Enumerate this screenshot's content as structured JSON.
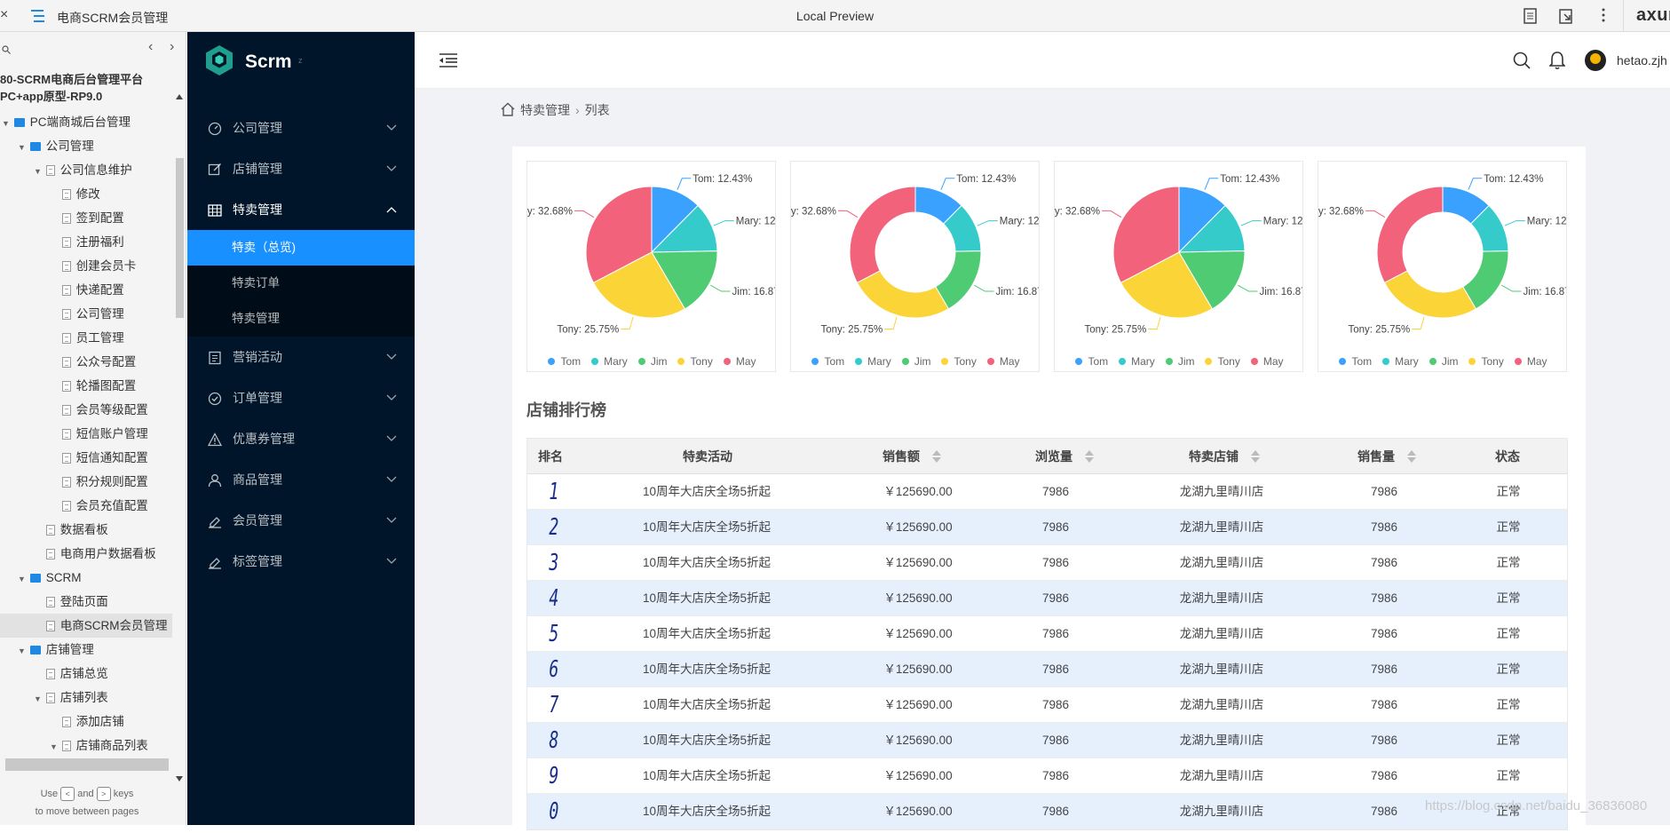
{
  "topbar": {
    "close": "×",
    "project_title": "电商SCRM会员管理",
    "preview_label": "Local Preview",
    "brand": "axur"
  },
  "tree": {
    "title_line1": "80-SCRM电商后台管理平台",
    "title_line2": "PC+app原型-RP9.0",
    "items": [
      {
        "label": "PC端商城后台管理",
        "type": "folder",
        "level": 0,
        "expanded": true
      },
      {
        "label": "公司管理",
        "type": "folder",
        "level": 1,
        "expanded": true
      },
      {
        "label": "公司信息维护",
        "type": "page",
        "level": 2,
        "expanded": true
      },
      {
        "label": "修改",
        "type": "page",
        "level": 3
      },
      {
        "label": "签到配置",
        "type": "page",
        "level": 3
      },
      {
        "label": "注册福利",
        "type": "page",
        "level": 3
      },
      {
        "label": "创建会员卡",
        "type": "page",
        "level": 3
      },
      {
        "label": "快递配置",
        "type": "page",
        "level": 3
      },
      {
        "label": "公司管理",
        "type": "page",
        "level": 3
      },
      {
        "label": "员工管理",
        "type": "page",
        "level": 3
      },
      {
        "label": "公众号配置",
        "type": "page",
        "level": 3
      },
      {
        "label": "轮播图配置",
        "type": "page",
        "level": 3
      },
      {
        "label": "会员等级配置",
        "type": "page",
        "level": 3
      },
      {
        "label": "短信账户管理",
        "type": "page",
        "level": 3
      },
      {
        "label": "短信通知配置",
        "type": "page",
        "level": 3
      },
      {
        "label": "积分规则配置",
        "type": "page",
        "level": 3
      },
      {
        "label": "会员充值配置",
        "type": "page",
        "level": 3
      },
      {
        "label": "数据看板",
        "type": "page",
        "level": 2
      },
      {
        "label": "电商用户数据看板",
        "type": "page",
        "level": 2
      },
      {
        "label": "SCRM",
        "type": "folder",
        "level": 1,
        "expanded": true
      },
      {
        "label": "登陆页面",
        "type": "page",
        "level": 2
      },
      {
        "label": "电商SCRM会员管理",
        "type": "page",
        "level": 2,
        "selected": true
      },
      {
        "label": "店铺管理",
        "type": "folder",
        "level": 1,
        "expanded": true
      },
      {
        "label": "店铺总览",
        "type": "page",
        "level": 2
      },
      {
        "label": "店铺列表",
        "type": "page",
        "level": 2,
        "expanded": true
      },
      {
        "label": "添加店铺",
        "type": "page",
        "level": 3
      },
      {
        "label": "店铺商品列表",
        "type": "page",
        "level": 3,
        "expanded": true
      }
    ],
    "hint_use": "Use",
    "hint_and": "and",
    "hint_keys": "keys",
    "hint_line2": "to move between pages",
    "key_left": "<",
    "key_right": ">"
  },
  "sidebar": {
    "logo_text": "Scrm",
    "logo_sub": "z",
    "menu": [
      {
        "label": "公司管理",
        "icon": "dashboard-icon",
        "open": false
      },
      {
        "label": "店铺管理",
        "icon": "edit-icon",
        "open": false
      },
      {
        "label": "特卖管理",
        "icon": "table-icon",
        "open": true,
        "children": [
          {
            "label": "特卖（总览)",
            "active": true
          },
          {
            "label": "特卖订单",
            "active": false
          },
          {
            "label": "特卖管理",
            "active": false
          }
        ]
      },
      {
        "label": "营销活动",
        "icon": "profile-icon",
        "open": false
      },
      {
        "label": "订单管理",
        "icon": "check-circle-icon",
        "open": false
      },
      {
        "label": "优惠券管理",
        "icon": "warning-icon",
        "open": false
      },
      {
        "label": "商品管理",
        "icon": "user-icon",
        "open": false
      },
      {
        "label": "会员管理",
        "icon": "highlight-icon",
        "open": false
      },
      {
        "label": "标签管理",
        "icon": "highlight-icon",
        "open": false
      }
    ]
  },
  "header": {
    "username": "hetao.zjh"
  },
  "breadcrumb": {
    "items": [
      "特卖管理",
      "列表"
    ]
  },
  "chart_data": [
    {
      "type": "pie",
      "donut": false,
      "series": [
        {
          "name": "",
          "labels": [
            "Tom",
            "Mary",
            "Jim",
            "Tony",
            "May"
          ],
          "values": [
            12.43,
            12.27,
            16.87,
            25.75,
            32.68
          ]
        }
      ],
      "legend": [
        "Tom",
        "Mary",
        "Jim",
        "Tony",
        "May"
      ],
      "legend_position": "bottom"
    },
    {
      "type": "pie",
      "donut": true,
      "series": [
        {
          "name": "",
          "labels": [
            "Tom",
            "Mary",
            "Jim",
            "Tony",
            "May"
          ],
          "values": [
            12.43,
            12.27,
            16.87,
            25.75,
            32.68
          ]
        }
      ],
      "legend": [
        "Tom",
        "Mary",
        "Jim",
        "Tony",
        "May"
      ],
      "legend_position": "bottom"
    },
    {
      "type": "pie",
      "donut": false,
      "series": [
        {
          "name": "",
          "labels": [
            "Tom",
            "Mary",
            "Jim",
            "Tony",
            "May"
          ],
          "values": [
            12.43,
            12.27,
            16.87,
            25.75,
            32.68
          ]
        }
      ],
      "legend": [
        "Tom",
        "Mary",
        "Jim",
        "Tony",
        "May"
      ],
      "legend_position": "bottom"
    },
    {
      "type": "pie",
      "donut": true,
      "series": [
        {
          "name": "",
          "labels": [
            "Tom",
            "Mary",
            "Jim",
            "Tony",
            "May"
          ],
          "values": [
            12.43,
            12.27,
            16.87,
            25.75,
            32.68
          ]
        }
      ],
      "legend": [
        "Tom",
        "Mary",
        "Jim",
        "Tony",
        "May"
      ],
      "legend_position": "bottom"
    }
  ],
  "pie_visible_labels": {
    "tom": "Tom: 12.43%",
    "mary": "Mary: 12",
    "jim": "Jim: 16.87",
    "tony": "Tony: 25.75%",
    "may": "y: 32.68%"
  },
  "colors": {
    "Tom": "#3ba1ff",
    "Mary": "#36cbcb",
    "Jim": "#4ecb73",
    "Tony": "#fbd437",
    "May": "#f2637b",
    "primary": "#1890ff",
    "sidebar_bg": "#001529"
  },
  "ranking": {
    "title": "店铺排行榜",
    "columns": [
      "排名",
      "特卖活动",
      "销售额",
      "浏览量",
      "特卖店铺",
      "销售量",
      "状态"
    ],
    "sortable": [
      false,
      false,
      true,
      true,
      true,
      true,
      false
    ],
    "rows": [
      {
        "rank": "1",
        "activity": "10周年大店庆全场5折起",
        "sales": "￥125690.00",
        "views": "7986",
        "store": "龙湖九里晴川店",
        "volume": "7986",
        "status": "正常"
      },
      {
        "rank": "2",
        "activity": "10周年大店庆全场5折起",
        "sales": "￥125690.00",
        "views": "7986",
        "store": "龙湖九里晴川店",
        "volume": "7986",
        "status": "正常"
      },
      {
        "rank": "3",
        "activity": "10周年大店庆全场5折起",
        "sales": "￥125690.00",
        "views": "7986",
        "store": "龙湖九里晴川店",
        "volume": "7986",
        "status": "正常"
      },
      {
        "rank": "4",
        "activity": "10周年大店庆全场5折起",
        "sales": "￥125690.00",
        "views": "7986",
        "store": "龙湖九里晴川店",
        "volume": "7986",
        "status": "正常"
      },
      {
        "rank": "5",
        "activity": "10周年大店庆全场5折起",
        "sales": "￥125690.00",
        "views": "7986",
        "store": "龙湖九里晴川店",
        "volume": "7986",
        "status": "正常"
      },
      {
        "rank": "6",
        "activity": "10周年大店庆全场5折起",
        "sales": "￥125690.00",
        "views": "7986",
        "store": "龙湖九里晴川店",
        "volume": "7986",
        "status": "正常"
      },
      {
        "rank": "7",
        "activity": "10周年大店庆全场5折起",
        "sales": "￥125690.00",
        "views": "7986",
        "store": "龙湖九里晴川店",
        "volume": "7986",
        "status": "正常"
      },
      {
        "rank": "8",
        "activity": "10周年大店庆全场5折起",
        "sales": "￥125690.00",
        "views": "7986",
        "store": "龙湖九里晴川店",
        "volume": "7986",
        "status": "正常"
      },
      {
        "rank": "9",
        "activity": "10周年大店庆全场5折起",
        "sales": "￥125690.00",
        "views": "7986",
        "store": "龙湖九里晴川店",
        "volume": "7986",
        "status": "正常"
      },
      {
        "rank": "0",
        "activity": "10周年大店庆全场5折起",
        "sales": "￥125690.00",
        "views": "7986",
        "store": "龙湖九里晴川店",
        "volume": "7986",
        "status": "正常"
      }
    ]
  },
  "watermark": "https://blog.csdn.net/baidu_36836080"
}
